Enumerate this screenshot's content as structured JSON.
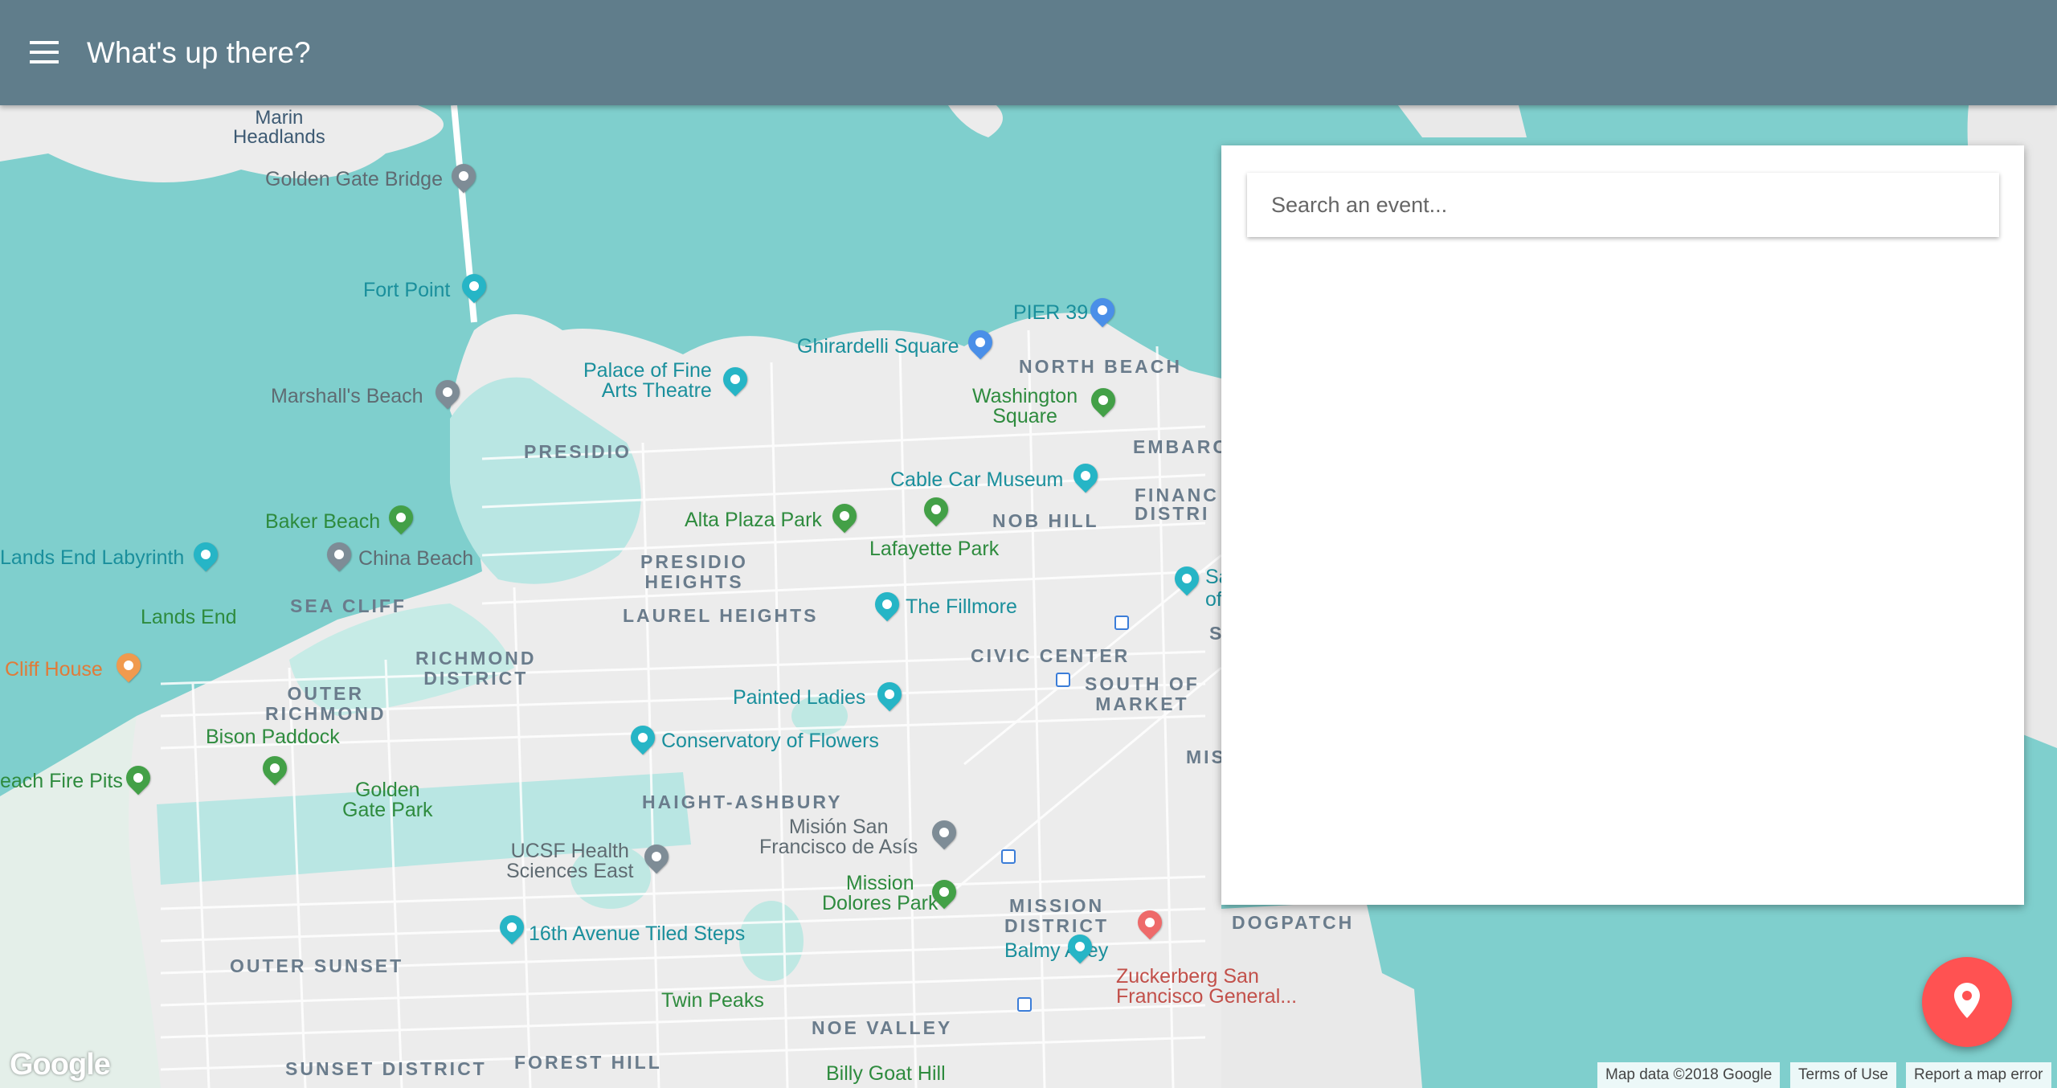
{
  "app": {
    "title": "What's up there?",
    "menu_icon": "hamburger-menu-icon",
    "colors": {
      "appbar": "#607d8b",
      "fab": "#ff5252",
      "water": "#7fcfcd"
    }
  },
  "search": {
    "placeholder": "Search an event...",
    "value": ""
  },
  "fab": {
    "icon": "location-pin-icon"
  },
  "map": {
    "labels": {
      "marin_headlands": "Marin\nHeadlands",
      "golden_gate_bridge": "Golden Gate Bridge",
      "fort_point": "Fort Point",
      "marshalls_beach": "Marshall's Beach",
      "palace_fine_arts": "Palace of Fine\nArts Theatre",
      "ghirardelli": "Ghirardelli Square",
      "pier39": "PIER 39",
      "north_beach": "NORTH BEACH",
      "washington_square": "Washington\nSquare",
      "embarcadero": "EMBARC",
      "financial_district": "FINANC\nDISTRI",
      "presidio": "PRESIDIO",
      "cable_car_museum": "Cable Car Museum",
      "alta_plaza": "Alta Plaza Park",
      "lafayette": "Lafayette Park",
      "nob_hill": "NOB HILL",
      "baker_beach": "Baker Beach",
      "china_beach": "China Beach",
      "lands_end_labyrinth": "Lands End Labyrinth",
      "presidio_heights": "PRESIDIO\nHEIGHTS",
      "lands_end": "Lands End",
      "sea_cliff": "SEA CLIFF",
      "laurel_heights": "LAUREL HEIGHTS",
      "the_fillmore": "The Fillmore",
      "civic_center": "CIVIC CENTER",
      "cliff_house": "Cliff House",
      "richmond_district": "RICHMOND\nDISTRICT",
      "south_of_market": "SOUTH OF\nMARKET",
      "outer_richmond": "OUTER\nRICHMOND",
      "painted_ladies": "Painted Ladies",
      "bison_paddock": "Bison Paddock",
      "conservatory": "Conservatory of Flowers",
      "beach_fire_pits": "each Fire Pits",
      "golden_gate_park": "Golden\nGate Park",
      "haight_ashbury": "HAIGHT-ASHBURY",
      "mision": "Misión San\nFrancisco de Asís",
      "ucsf": "UCSF Health\nSciences East",
      "mission_dolores": "Mission\nDolores Park",
      "mission_district": "MISSION\nDISTRICT",
      "dogpatch": "DOGPATCH",
      "tiled_steps": "16th Avenue Tiled Steps",
      "balmy_alley": "Balmy Alley",
      "zuckerberg": "Zuckerberg San\nFrancisco General...",
      "outer_sunset": "OUTER SUNSET",
      "twin_peaks": "Twin Peaks",
      "noe_valley": "NOE VALLEY",
      "sunset_district": "SUNSET DISTRICT",
      "forest_hill": "FOREST HILL",
      "billy_goat": "Billy Goat Hill",
      "mis": "MIS",
      "s": "S",
      "sa_of": "Sa\nof"
    },
    "google_logo": "Google",
    "attribution": {
      "data": "Map data ©2018 Google",
      "terms": "Terms of Use",
      "report": "Report a map error"
    }
  }
}
